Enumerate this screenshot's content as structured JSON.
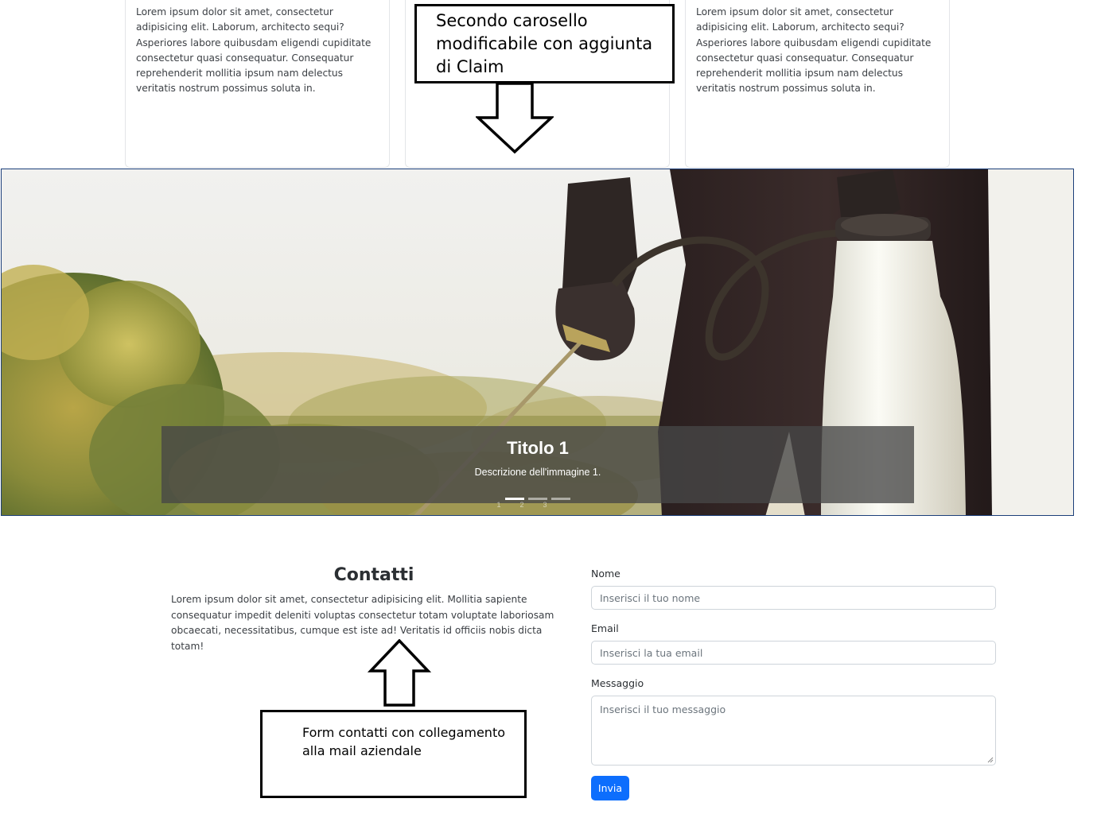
{
  "cards": [
    {
      "text": "Lorem ipsum dolor sit amet, consectetur adipisicing elit. Laborum, architecto sequi? Asperiores labore quibusdam eligendi cupiditate consectetur quasi consequatur. Consequatur reprehenderit mollitia ipsum nam delectus veritatis nostrum possimus soluta in."
    },
    {
      "text": ""
    },
    {
      "text": "Lorem ipsum dolor sit amet, consectetur adipisicing elit. Laborum, architecto sequi? Asperiores labore quibusdam eligendi cupiditate consectetur quasi consequatur. Consequatur reprehenderit mollitia ipsum nam delectus veritatis nostrum possimus soluta in."
    }
  ],
  "annotations": {
    "carousel_note": "Secondo carosello modificabile con aggiunta di Claim",
    "form_note": "Form contatti con collegamento alla mail aziendale"
  },
  "carousel": {
    "caption_title": "Titolo 1",
    "caption_description": "Descrizione dell'immagine 1.",
    "indicators": [
      {
        "number": "1",
        "active": true
      },
      {
        "number": "2",
        "active": false
      },
      {
        "number": "3",
        "active": false
      }
    ]
  },
  "contact": {
    "title": "Contatti",
    "text": "Lorem ipsum dolor sit amet, consectetur adipisicing elit. Mollitia sapiente consequatur impedit deleniti voluptas consectetur totam voluptate laboriosam obcaecati, necessitatibus, cumque est iste ad! Veritatis id officiis nobis dicta totam!",
    "form": {
      "name_label": "Nome",
      "name_placeholder": "Inserisci il tuo nome",
      "email_label": "Email",
      "email_placeholder": "Inserisci la tua email",
      "message_label": "Messaggio",
      "message_placeholder": "Inserisci il tuo messaggio",
      "submit_label": "Invia"
    }
  },
  "colors": {
    "primary": "#0d6efd",
    "carousel_border": "#1c3f7a"
  }
}
